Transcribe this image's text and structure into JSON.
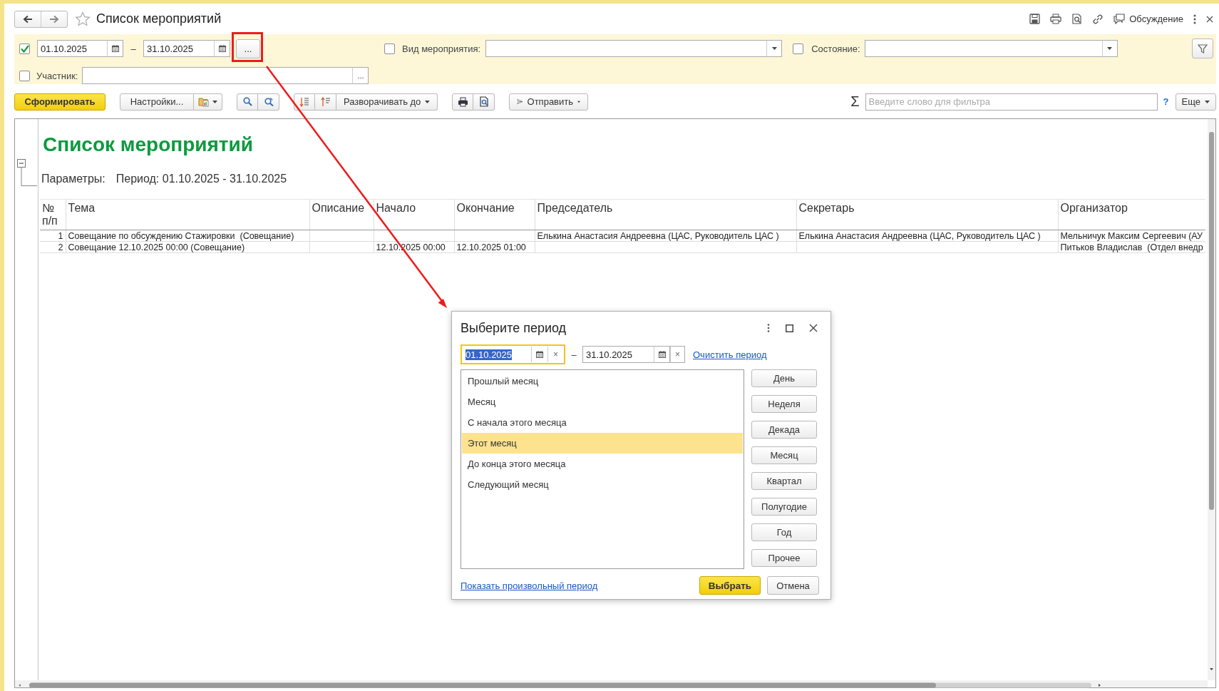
{
  "window": {
    "title": "Список мероприятий",
    "discussion": "Обсуждение"
  },
  "filters": {
    "period": {
      "enabled": true,
      "from": "01.10.2025",
      "separator": "–",
      "to": "31.10.2025",
      "choose_button": "..."
    },
    "event_type": {
      "checked": false,
      "label": "Вид мероприятия:"
    },
    "state": {
      "checked": false,
      "label": "Состояние:"
    },
    "participant": {
      "checked": false,
      "label": "Участник:",
      "choose_button": "..."
    }
  },
  "toolbar": {
    "generate": "Сформировать",
    "settings": "Настройки...",
    "expand": "Разворачивать до",
    "send": "Отправить",
    "sum": "Σ",
    "search_placeholder": "Введите слово для фильтра",
    "help": "?",
    "more": "Еще"
  },
  "report": {
    "title": "Список мероприятий",
    "params_label": "Параметры:",
    "params_value": "Период: 01.10.2025 - 31.10.2025",
    "columns": [
      "№ п/п",
      "Тема",
      "Описание",
      "Начало",
      "Окончание",
      "Председатель",
      "Секретарь",
      "Организатор"
    ],
    "rows": [
      [
        "1",
        "Совещание по обсуждению Стажировки  (Совещание)",
        "",
        "",
        "",
        "Елькина Анастасия Андреевна (ЦАС, Руководитель ЦАС )",
        "Елькина Анастасия Андреевна (ЦАС, Руководитель ЦАС )",
        "Мельничук Максим Сергеевич (АУ"
      ],
      [
        "2",
        "Совещание 12.10.2025 00:00 (Совещание)",
        "",
        "12.10.2025 00:00",
        "12.10.2025 01:00",
        "",
        "",
        "Питьков Владислав  (Отдел внедр"
      ]
    ]
  },
  "dialog": {
    "title": "Выберите период",
    "from": "01.10.2025",
    "from_clear": "×",
    "separator": "–",
    "to": "31.10.2025",
    "to_clear": "×",
    "clear_link": "Очистить период",
    "presets": [
      {
        "label": "Прошлый месяц",
        "selected": false
      },
      {
        "label": "Месяц",
        "selected": false
      },
      {
        "label": "С начала этого месяца",
        "selected": false
      },
      {
        "label": "Этот месяц",
        "selected": true
      },
      {
        "label": "До конца этого месяца",
        "selected": false
      },
      {
        "label": "Следующий месяц",
        "selected": false
      }
    ],
    "period_buttons": [
      "День",
      "Неделя",
      "Декада",
      "Месяц",
      "Квартал",
      "Полугодие",
      "Год",
      "Прочее"
    ],
    "custom_link": "Показать произвольный период",
    "ok": "Выбрать",
    "cancel": "Отмена"
  }
}
